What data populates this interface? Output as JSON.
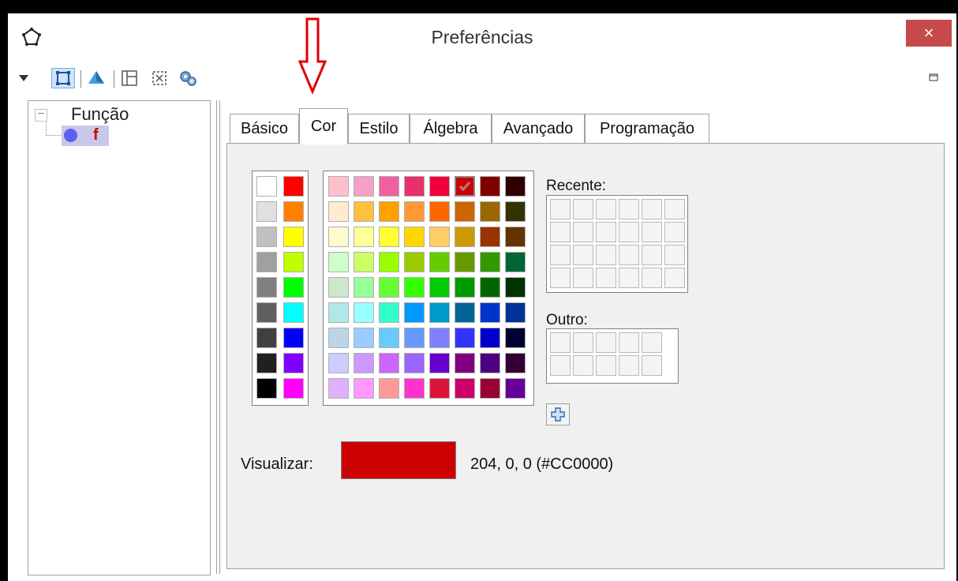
{
  "window": {
    "title": "Preferências",
    "close_label": "×"
  },
  "toolbar": {
    "buttons": [
      "dropdown-icon",
      "graphics-view-icon",
      "graphics-3d-icon",
      "layout-icon",
      "defaults-icon",
      "advanced-icon"
    ]
  },
  "tree": {
    "root_label": "Função",
    "collapse_glyph": "−",
    "child_label": "f"
  },
  "tabs": [
    {
      "label": "Básico"
    },
    {
      "label": "Cor"
    },
    {
      "label": "Estilo"
    },
    {
      "label": "Álgebra"
    },
    {
      "label": "Avançado"
    },
    {
      "label": "Programação"
    }
  ],
  "color_panel": {
    "recent_label": "Recente:",
    "other_label": "Outro:",
    "preview_label": "Visualizar:",
    "preview_value": "204, 0, 0 (#CC0000)",
    "selected_color": "#CC0000",
    "gray_column": [
      "#FFFFFF",
      "#E0E0E0",
      "#C0C0C0",
      "#A0A0A0",
      "#808080",
      "#606060",
      "#404040",
      "#202020",
      "#000000"
    ],
    "primary_column": [
      "#FF0000",
      "#FF8000",
      "#FFFF00",
      "#BFFF00",
      "#00FF00",
      "#00FFFF",
      "#0000FF",
      "#8000FF",
      "#FF00FF"
    ],
    "main_grid": [
      [
        "#FFC0CB",
        "#F5A0C8",
        "#F060A0",
        "#E8306A",
        "#F0003C",
        "#CC0000",
        "#800000",
        "#300000"
      ],
      [
        "#FFEBCD",
        "#FFC040",
        "#FFA000",
        "#FF9933",
        "#FF6600",
        "#CC6600",
        "#996600",
        "#333300"
      ],
      [
        "#FFFACD",
        "#FFFF99",
        "#FFFF33",
        "#FFD700",
        "#FFCC66",
        "#CC9900",
        "#993300",
        "#663300"
      ],
      [
        "#CCFFCC",
        "#CCFF66",
        "#99FF00",
        "#99CC00",
        "#66CC00",
        "#669900",
        "#339900",
        "#006633"
      ],
      [
        "#CCE8CC",
        "#99FF99",
        "#66FF33",
        "#33FF00",
        "#00CC00",
        "#009900",
        "#006600",
        "#003300"
      ],
      [
        "#B0E8E8",
        "#99FFFF",
        "#33FFCC",
        "#0099FF",
        "#0099CC",
        "#006699",
        "#0033CC",
        "#003399"
      ],
      [
        "#BCD4E6",
        "#99CCFF",
        "#66CCFF",
        "#6699FF",
        "#8080FF",
        "#3333FF",
        "#0000CC",
        "#000033"
      ],
      [
        "#CCCCFF",
        "#CC99FF",
        "#CC66FF",
        "#9966FF",
        "#6600CC",
        "#800080",
        "#4B0082",
        "#330033"
      ],
      [
        "#E0B0FF",
        "#FF99FF",
        "#FF9999",
        "#FF33CC",
        "#DC143C",
        "#CC0066",
        "#990033",
        "#660099"
      ]
    ],
    "selected_index": [
      0,
      5
    ]
  }
}
